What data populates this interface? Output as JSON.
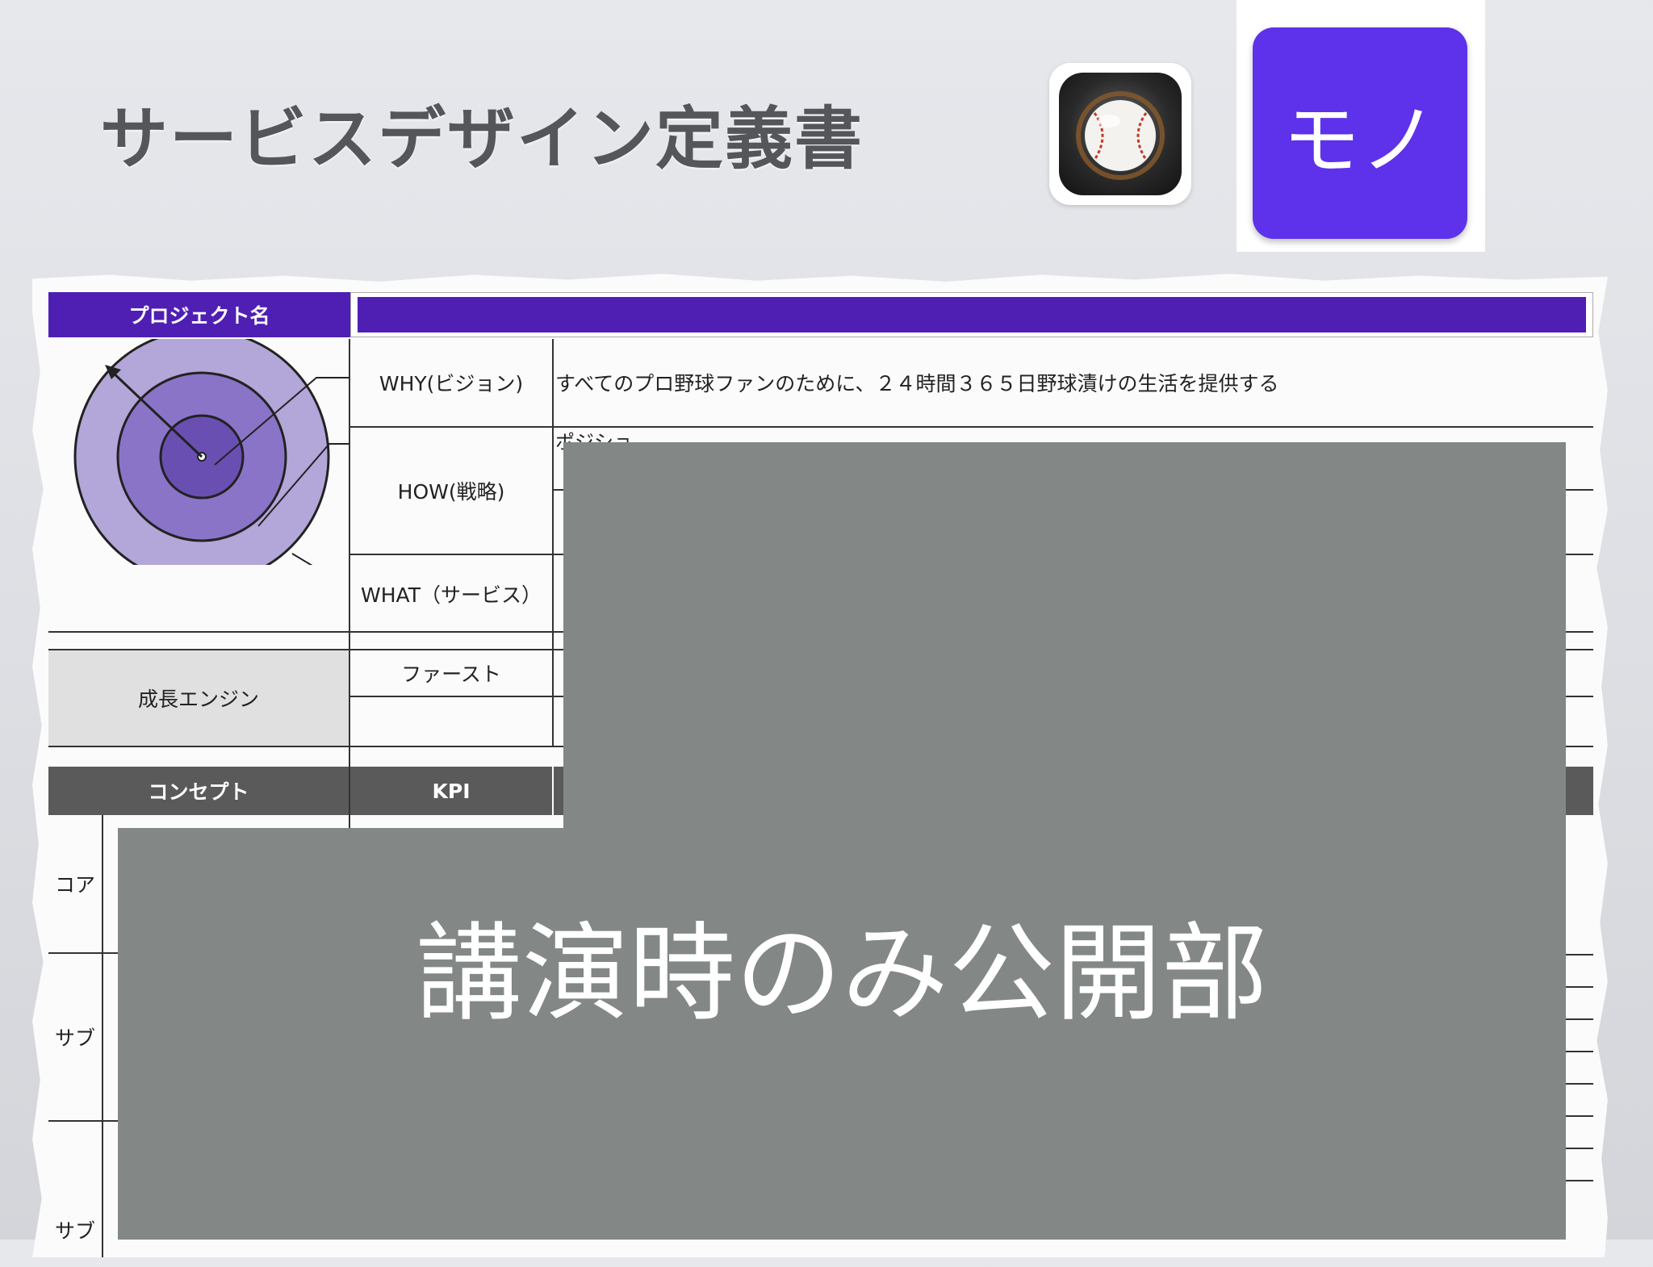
{
  "title": "サービスデザイン定義書",
  "mono_label": "モノ",
  "table": {
    "project_name_label": "プロジェクト名",
    "why_label": "WHY(ビジョン)",
    "why_value": "すべてのプロ野球ファンのために、２４時間３６５日野球漬けの生活を提供する",
    "position_label_fragment": "ポジショ",
    "how_label": "HOW(戦略)",
    "what_label": "WHAT（サービス）",
    "growth_engine_label": "成長エンジン",
    "first_label": "ファースト",
    "concept_header": "コンセプト",
    "kpi_header": "KPI",
    "core_label": "コア",
    "sub_label_1": "サブ",
    "sub_label_2": "サブ"
  },
  "overlay_text": "講演時のみ公開部",
  "colors": {
    "accent_purple": "#4f1fb4",
    "mono_button": "#5d32ea",
    "overlay_gray": "#838786",
    "target_outer": "#b3a6d9",
    "target_mid": "#8a74c8",
    "target_inner": "#6a4fb3"
  },
  "icons": [
    "baseball-app-icon",
    "target-diagram"
  ]
}
